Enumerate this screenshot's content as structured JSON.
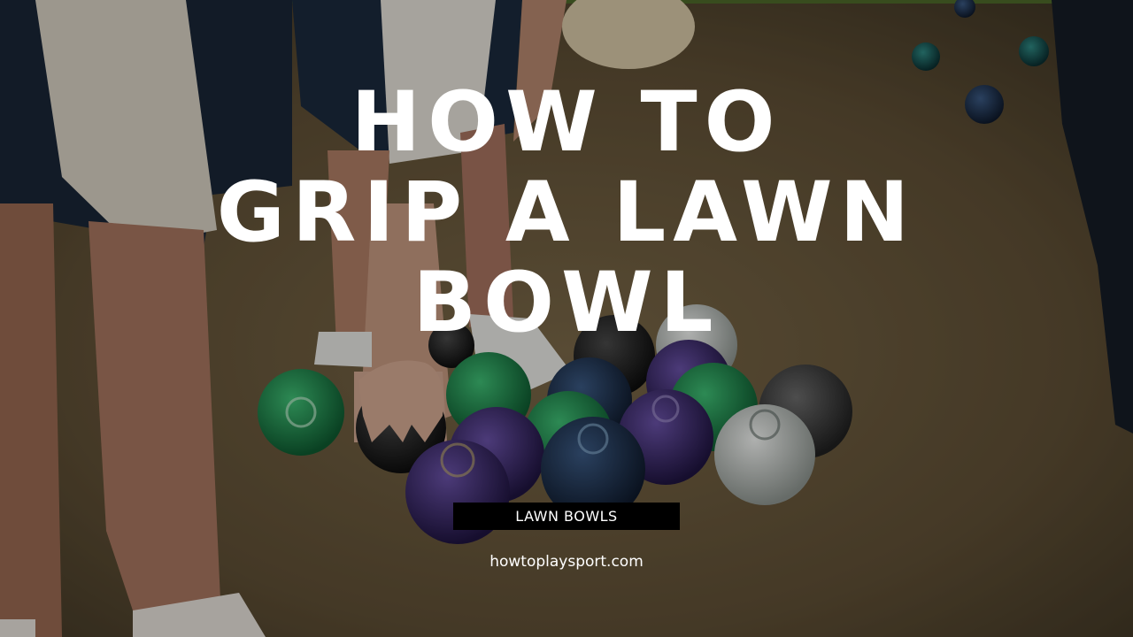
{
  "hero": {
    "background_description_icon": "lawn-bowls-photo",
    "title_lines": [
      "HOW TO",
      "GRIP A LAWN",
      "BOWL"
    ],
    "category_badge": "LAWN BOWLS",
    "site": "howtoplaysport.com",
    "colors": {
      "title": "#ffffff",
      "badge_bg": "#000000",
      "badge_text": "#ffffff",
      "grass": "#6b5a3c",
      "bowl_green": "#1f8a4c",
      "bowl_navy": "#1d2c46",
      "bowl_purple": "#3a2a6a",
      "bowl_white": "#d8dcd8",
      "bowl_black": "#1a1a1a"
    }
  }
}
